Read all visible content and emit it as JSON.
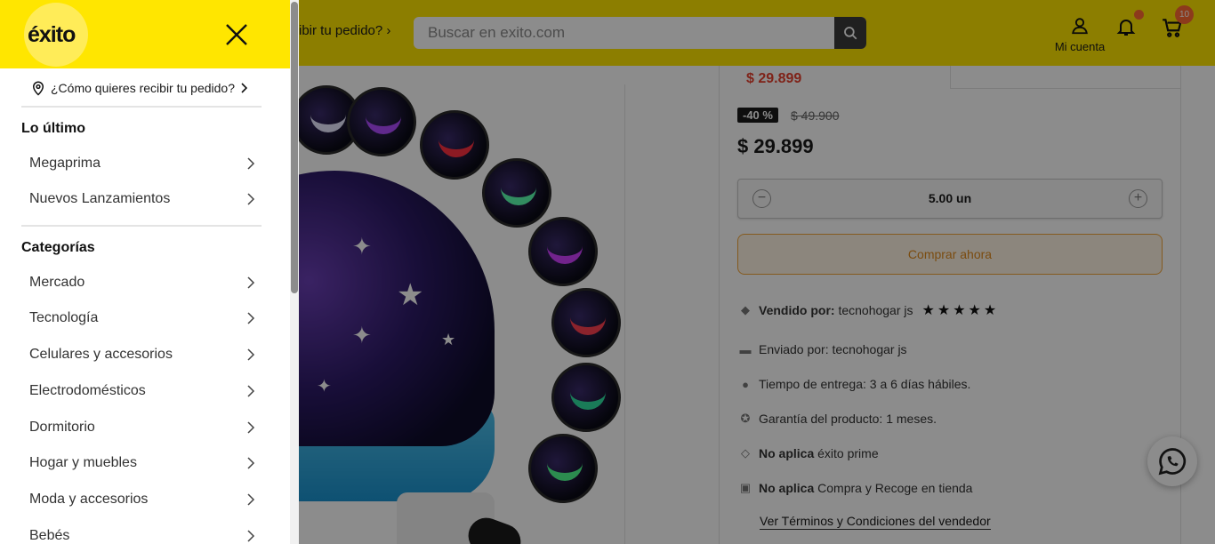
{
  "header": {
    "delivery_text": "ibir tu pedido?",
    "search_placeholder": "Buscar en exito.com",
    "account_label": "Mi cuenta",
    "cart_count": "10"
  },
  "product": {
    "small_price": "$ 29.899",
    "discount_badge": "-40 %",
    "old_price": "$ 49.900",
    "price": "$ 29.899",
    "quantity": "5.00 un",
    "buy_button": "Comprar ahora",
    "sold_by_label": "Vendido por:",
    "sold_by_value": "tecnohogar js",
    "rating_stars": 5,
    "shipped_by_label": "Enviado por:",
    "shipped_by_value": "tecnohogar js",
    "delivery_time_label": "Tiempo de entrega:",
    "delivery_time_value": "3 a 6 días hábiles.",
    "warranty_label": "Garantía del producto:",
    "warranty_value": "1 meses.",
    "prime_label": "No aplica",
    "prime_value": "éxito prime",
    "pickup_label": "No aplica",
    "pickup_value": "Compra y Recoge en tienda",
    "terms_link": "Ver Términos y Condiciones del vendedor"
  },
  "drawer": {
    "logo": "éxito",
    "delivery_question": "¿Cómo quieres recibir tu pedido?",
    "section_latest": "Lo último",
    "latest_items": [
      {
        "label": "Megaprima"
      },
      {
        "label": "Nuevos Lanzamientos"
      }
    ],
    "section_categories": "Categorías",
    "category_items": [
      {
        "label": "Mercado"
      },
      {
        "label": "Tecnología"
      },
      {
        "label": "Celulares y accesorios"
      },
      {
        "label": "Electrodomésticos"
      },
      {
        "label": "Dormitorio"
      },
      {
        "label": "Hogar y muebles"
      },
      {
        "label": "Moda y accesorios"
      },
      {
        "label": "Bebés"
      }
    ]
  },
  "colors": {
    "brand_yellow": "#ffe600",
    "accent_orange": "#ff6a33",
    "price_red": "#e8402e"
  },
  "icons": [
    "location-pin-icon",
    "close-icon",
    "chevron-right-icon",
    "search-icon",
    "user-icon",
    "bell-icon",
    "cart-icon",
    "whatsapp-icon",
    "tag-icon",
    "truck-icon",
    "clock-icon",
    "badge-check-icon",
    "diamond-icon",
    "store-icon"
  ]
}
